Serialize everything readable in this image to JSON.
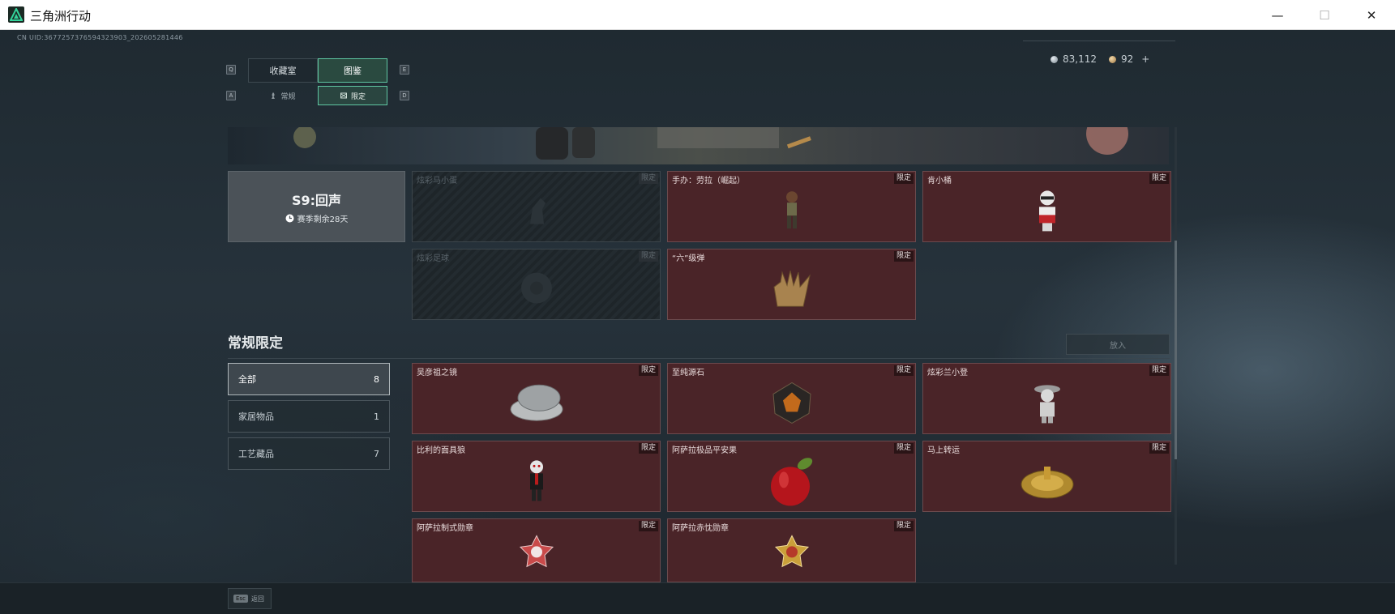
{
  "window": {
    "title": "三角洲行动",
    "minimize": "—",
    "maximize": "☐",
    "close": "✕"
  },
  "uid": "CN UID:3677257376594323903_202605281446",
  "currency": {
    "silver": "83,112",
    "gold": "92",
    "add": "+"
  },
  "hotkeys": {
    "left": "Q",
    "right": "E",
    "sub_left": "A",
    "sub_right": "D"
  },
  "tabs": [
    {
      "label": "收藏室"
    },
    {
      "label": "图鉴"
    }
  ],
  "subtabs": [
    {
      "label": "常规"
    },
    {
      "label": "限定"
    }
  ],
  "season": {
    "name": "S9:回声",
    "remaining": "赛季剩余28天"
  },
  "season_items": [
    {
      "name": "炫彩马小蛋",
      "tag": "限定",
      "locked": true
    },
    {
      "name": "手办：劳拉（崛起）",
      "tag": "限定",
      "locked": false
    },
    {
      "name": "肯小桶",
      "tag": "限定",
      "locked": false
    },
    {
      "name": "炫彩足球",
      "tag": "限定",
      "locked": true
    },
    {
      "name": "“六”级弹",
      "tag": "限定",
      "locked": false
    }
  ],
  "section": {
    "title": "常规限定",
    "put_in": "放入"
  },
  "categories": [
    {
      "label": "全部",
      "count": "8"
    },
    {
      "label": "家居物品",
      "count": "1"
    },
    {
      "label": "工艺藏品",
      "count": "7"
    }
  ],
  "regular_items": [
    {
      "name": "吴彦祖之镜",
      "tag": "限定"
    },
    {
      "name": "至纯源石",
      "tag": "限定"
    },
    {
      "name": "炫彩兰小登",
      "tag": "限定"
    },
    {
      "name": "比利的面具狼",
      "tag": "限定"
    },
    {
      "name": "阿萨拉极品平安果",
      "tag": "限定"
    },
    {
      "name": "马上转运",
      "tag": "限定"
    },
    {
      "name": "阿萨拉制式勋章",
      "tag": "限定"
    },
    {
      "name": "阿萨拉赤忱勋章",
      "tag": "限定"
    }
  ],
  "footer": {
    "esc_key": "Esc",
    "back": "返回"
  },
  "colors": {
    "accent": "#5fc6a2",
    "card_bg": "#4a2428",
    "tag_bg": "#2a1416"
  }
}
